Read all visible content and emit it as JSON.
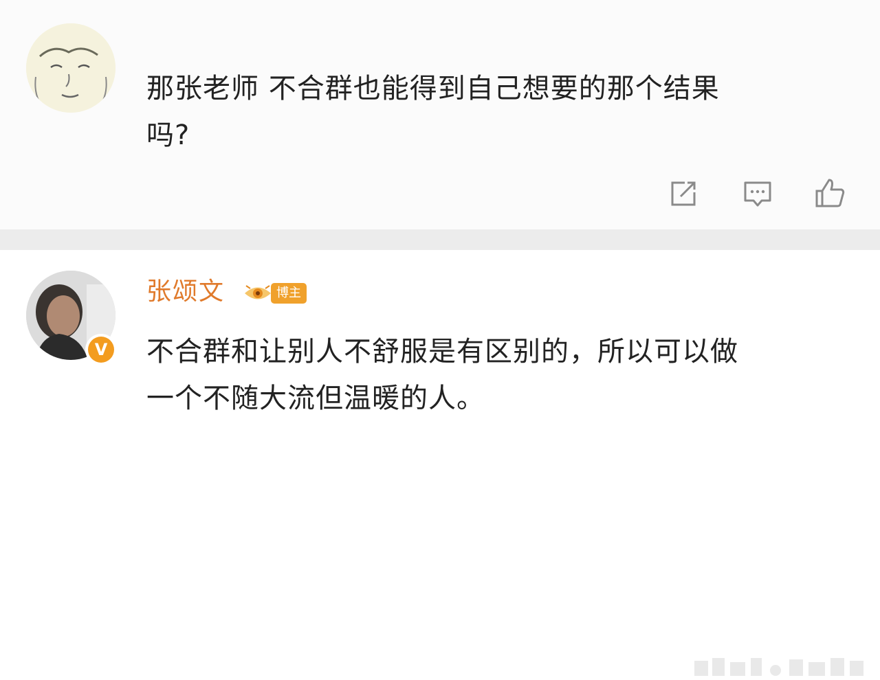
{
  "comment_1": {
    "text_line_1": "那张老师 不合群也能得到自己想要的那个结果",
    "text_line_2": "吗?",
    "actions": {
      "share_icon": "share-icon",
      "comment_icon": "comment-icon",
      "like_icon": "like-icon"
    }
  },
  "comment_2": {
    "username": "张颂文",
    "badge": "博主",
    "verified_mark": "V",
    "text_line_1": "不合群和让别人不舒服是有区别的，所以可以做",
    "text_line_2": "一个不随大流但温暖的人。"
  },
  "colors": {
    "username": "#e07a2b",
    "badge": "#f0a12c",
    "verified": "#f39c1f",
    "divider": "#ececec",
    "icon_stroke": "#8a8a8a"
  }
}
